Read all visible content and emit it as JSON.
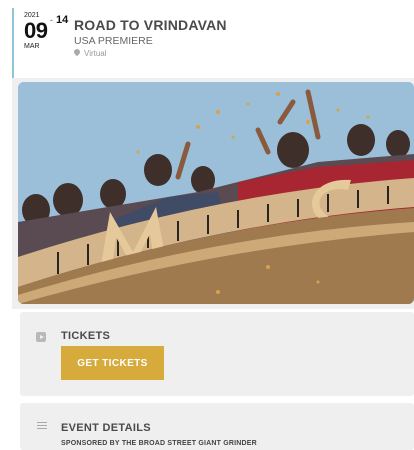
{
  "event": {
    "year": "2021",
    "day": "09",
    "dash": "-",
    "end_day": "14",
    "month": "MAR",
    "title": "ROAD TO VRINDAVAN",
    "subtitle": "USA PREMIERE",
    "venue": "Virtual"
  },
  "tickets": {
    "heading": "TICKETS",
    "button_label": "GET TICKETS",
    "accent_color": "#d6ab3c"
  },
  "details": {
    "heading": "EVENT DETAILS",
    "sponsor": "SPONSORED BY THE BROAD STREET GIANT GRINDER"
  }
}
